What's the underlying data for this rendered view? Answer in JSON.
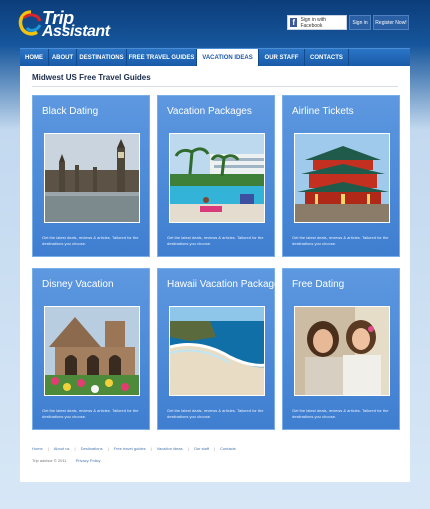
{
  "logo": {
    "line1": "Trip",
    "line2": "Assistant"
  },
  "auth": {
    "facebook_label": "Sign in with Facebook",
    "signin_label": "Sign in",
    "register_label": "Register Now!"
  },
  "nav": {
    "items": [
      {
        "label": "Home"
      },
      {
        "label": "About"
      },
      {
        "label": "Destinations"
      },
      {
        "label": "Free Travel Guides"
      },
      {
        "label": "Vacation Ideas"
      },
      {
        "label": "Our Staff"
      },
      {
        "label": "Contacts"
      }
    ],
    "active_index": 4
  },
  "page": {
    "title": "Midwest US Free Travel Guides"
  },
  "cards": [
    {
      "title": "Black Dating",
      "desc": "Get the latest deals, reviews & articles. Tailored for the destinations you choose."
    },
    {
      "title": "Vacation Packages",
      "desc": "Get the latest deals, reviews & articles. Tailored for the destinations you choose."
    },
    {
      "title": "Airline Tickets",
      "desc": "Get the latest deals, reviews & articles. Tailored for the destinations you choose."
    },
    {
      "title": "Disney Vacation",
      "desc": "Get the latest deals, reviews & articles. Tailored for the destinations you choose."
    },
    {
      "title": "Hawaii Vacation Package",
      "desc": "Get the latest deals, reviews & articles. Tailored for the destinations you choose."
    },
    {
      "title": "Free Dating",
      "desc": "Get the latest deals, reviews & articles. Tailored for the destinations you choose."
    }
  ],
  "footer": {
    "links": [
      "Home",
      "About us",
      "Destinations",
      "Free travel guides",
      "Vacation ideas",
      "Our staff",
      "Contacts"
    ],
    "copyright": "Trip advisor © 2011",
    "privacy": "Privacy Policy"
  }
}
